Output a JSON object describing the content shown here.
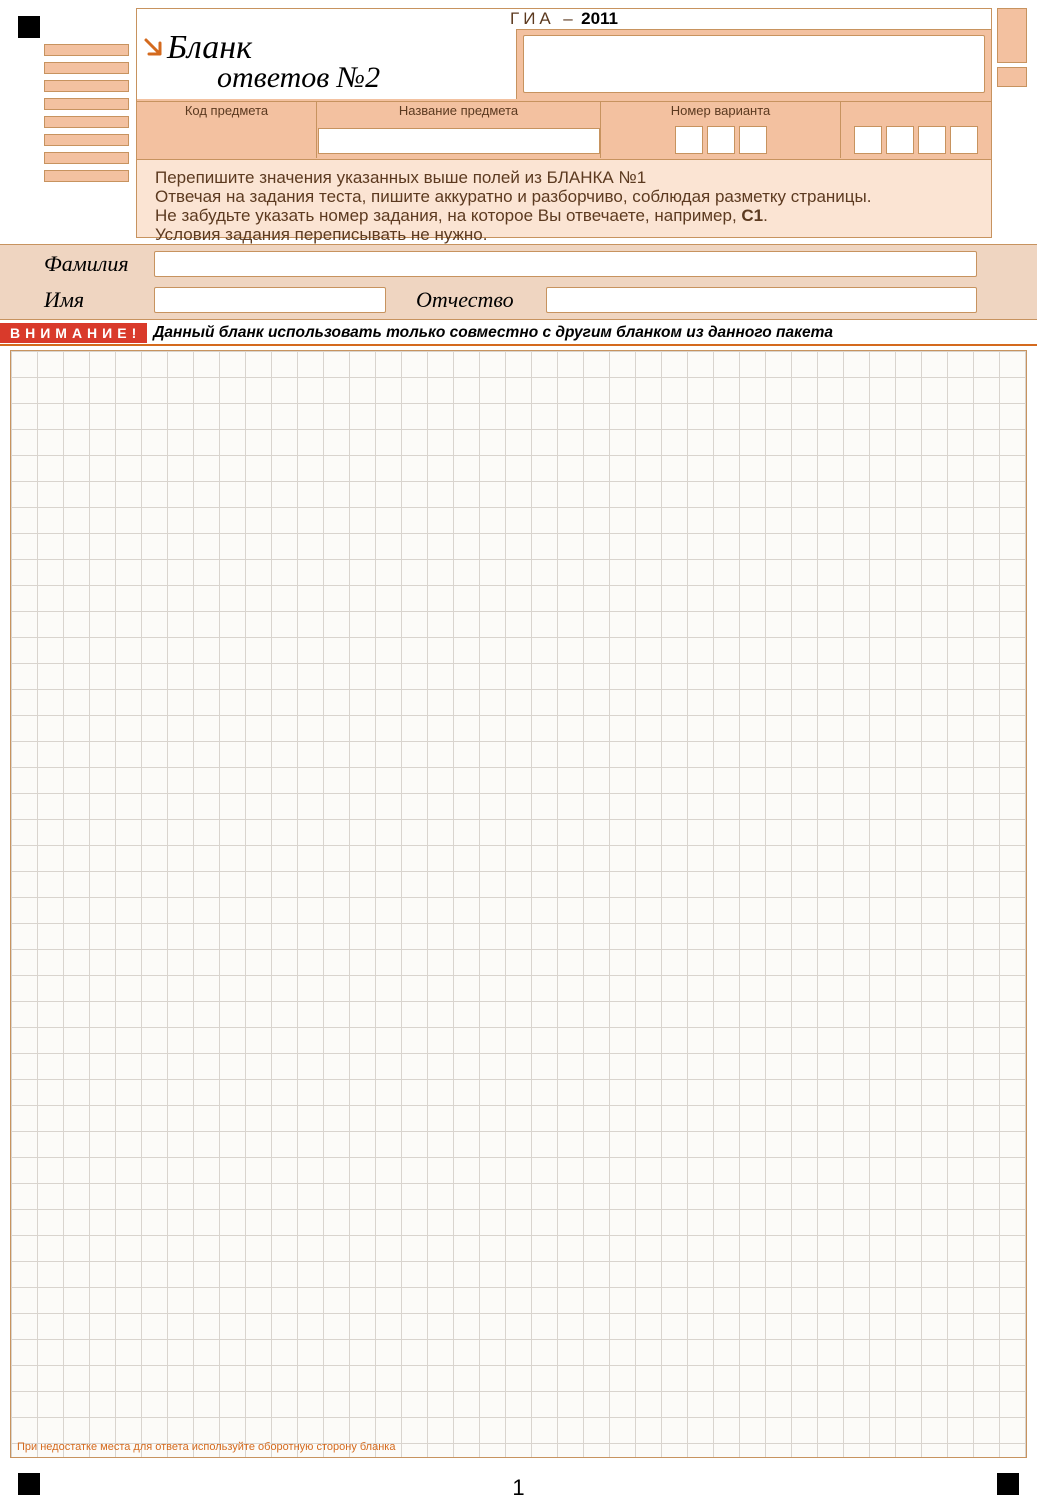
{
  "header": {
    "exam": "ГИА",
    "dash": "–",
    "year": "2011",
    "title_line1": "Бланк",
    "title_line2": "ответов №2",
    "labels": {
      "kod": "Код предмета",
      "nazv": "Название предмета",
      "variant": "Номер варианта"
    }
  },
  "instructions": {
    "l1": "Перепишите значения указанных выше полей из БЛАНКА №1",
    "l2": "Отвечая на задания теста, пишите аккуратно и разборчиво, соблюдая разметку страницы.",
    "l3_a": "Не забудьте указать номер задания, на которое Вы отвечаете, например, ",
    "l3_b": "С1",
    "l3_c": ".",
    "l4": "Условия задания переписывать не нужно."
  },
  "name": {
    "surname_label": "Фамилия",
    "name_label": "Имя",
    "patronymic_label": "Отчество",
    "surname_value": "",
    "name_value": "",
    "patronymic_value": ""
  },
  "warning": {
    "tag": "ВНИМАНИЕ!",
    "text": "Данный бланк использовать только совместно с  другим бланком из данного пакета"
  },
  "footer_note": "При недостатке места для ответа используйте оборотную сторону бланка",
  "page_number": "1"
}
